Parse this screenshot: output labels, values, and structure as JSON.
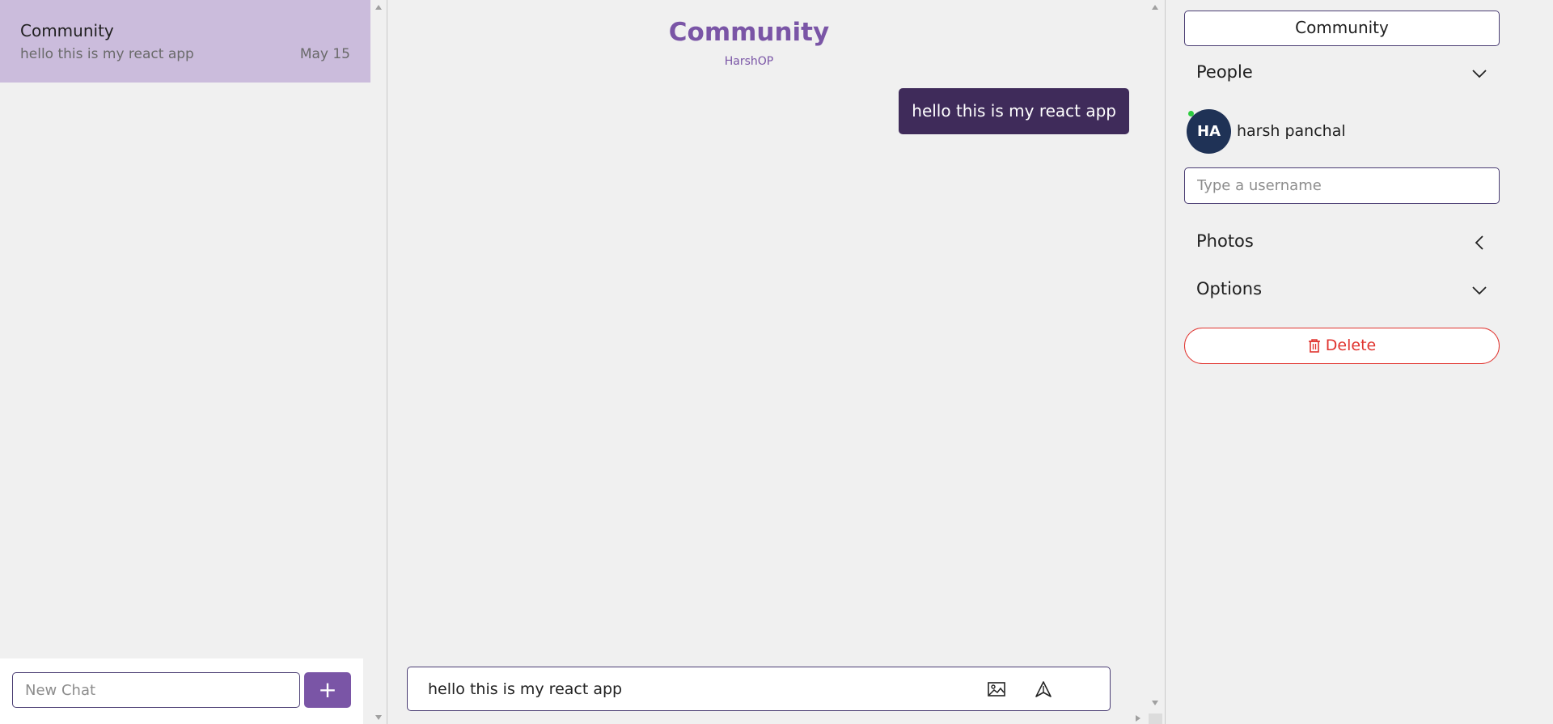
{
  "chat_list": {
    "items": [
      {
        "title": "Community",
        "preview": "hello this is my react app",
        "date": "May 15"
      }
    ]
  },
  "new_chat": {
    "placeholder": "New Chat",
    "add_label": "+"
  },
  "chat_header": {
    "title": "Community",
    "subtitle": "HarshOP"
  },
  "messages": [
    {
      "text": "hello this is my react app"
    }
  ],
  "message_input": {
    "value": "hello this is my react app"
  },
  "settings": {
    "chat_title": "Community",
    "people_label": "People",
    "people": [
      {
        "initials": "HA",
        "name": "harsh panchal",
        "online": true
      }
    ],
    "username_placeholder": "Type a username",
    "photos_label": "Photos",
    "options_label": "Options",
    "delete_label": "Delete"
  },
  "colors": {
    "accent": "#7a55a6",
    "selected_chat": "#cbbcdc",
    "bubble": "#3f2b5a",
    "avatar": "#1f3256",
    "danger": "#e0332e"
  }
}
